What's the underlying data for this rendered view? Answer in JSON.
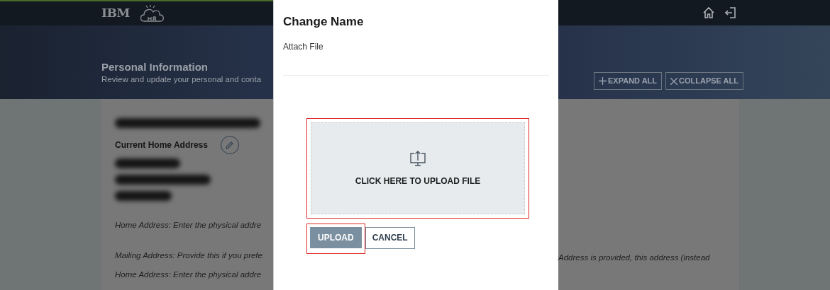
{
  "header": {
    "logo": "IBM"
  },
  "hero": {
    "title": "Personal Information",
    "subtitle": "Review and update your personal and conta",
    "actions": [
      {
        "kind": "expand",
        "label": "EXPAND ALL"
      },
      {
        "kind": "collapse",
        "label": "COLLAPSE ALL"
      }
    ]
  },
  "card": {
    "address_label": "Current Home Address",
    "notes_left": [
      "Home Address: Enter the physical addre",
      "Mailing Address: Provide this if you prefe",
      "Home Address: Enter the physical addre"
    ],
    "note_right": "Address is provided, this address (instead"
  },
  "modal": {
    "title": "Change Name",
    "field_label": "Attach File",
    "dropzone": {
      "text": "CLICK HERE TO UPLOAD FILE",
      "highlighted": true
    },
    "buttons": [
      {
        "kind": "primary",
        "label": "UPLOAD",
        "highlighted": true
      },
      {
        "kind": "secondary",
        "label": "CANCEL",
        "highlighted": false
      }
    ]
  }
}
